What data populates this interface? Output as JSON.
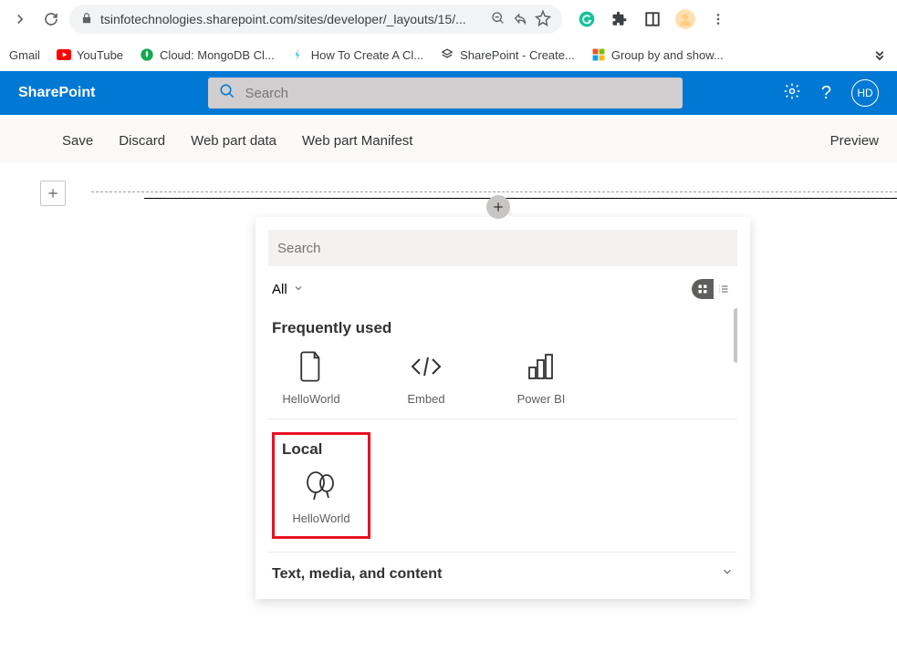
{
  "browser": {
    "url": "tsinfotechnologies.sharepoint.com/sites/developer/_layouts/15/..."
  },
  "bookmarks": [
    {
      "label": "Gmail",
      "icon": "",
      "color": ""
    },
    {
      "label": "YouTube",
      "icon": "yt",
      "color": "#ff0000"
    },
    {
      "label": "Cloud: MongoDB Cl...",
      "icon": "mongo",
      "color": "#10aa50"
    },
    {
      "label": "How To Create A Cl...",
      "icon": "doc",
      "color": "#f0ad00"
    },
    {
      "label": "SharePoint - Create...",
      "icon": "sp",
      "color": "#333"
    },
    {
      "label": "Group by and show...",
      "icon": "ms",
      "color": ""
    }
  ],
  "sharepoint": {
    "brand": "SharePoint",
    "search_placeholder": "Search",
    "avatar": "HD"
  },
  "commands": {
    "save": "Save",
    "discard": "Discard",
    "data": "Web part data",
    "manifest": "Web part Manifest",
    "preview": "Preview"
  },
  "picker": {
    "search_placeholder": "Search",
    "filter": "All",
    "sections": {
      "frequently": "Frequently used",
      "local": "Local",
      "textmedia": "Text, media, and content"
    },
    "frequent": [
      {
        "label": "HelloWorld"
      },
      {
        "label": "Embed"
      },
      {
        "label": "Power BI"
      }
    ],
    "local": [
      {
        "label": "HelloWorld"
      }
    ]
  }
}
